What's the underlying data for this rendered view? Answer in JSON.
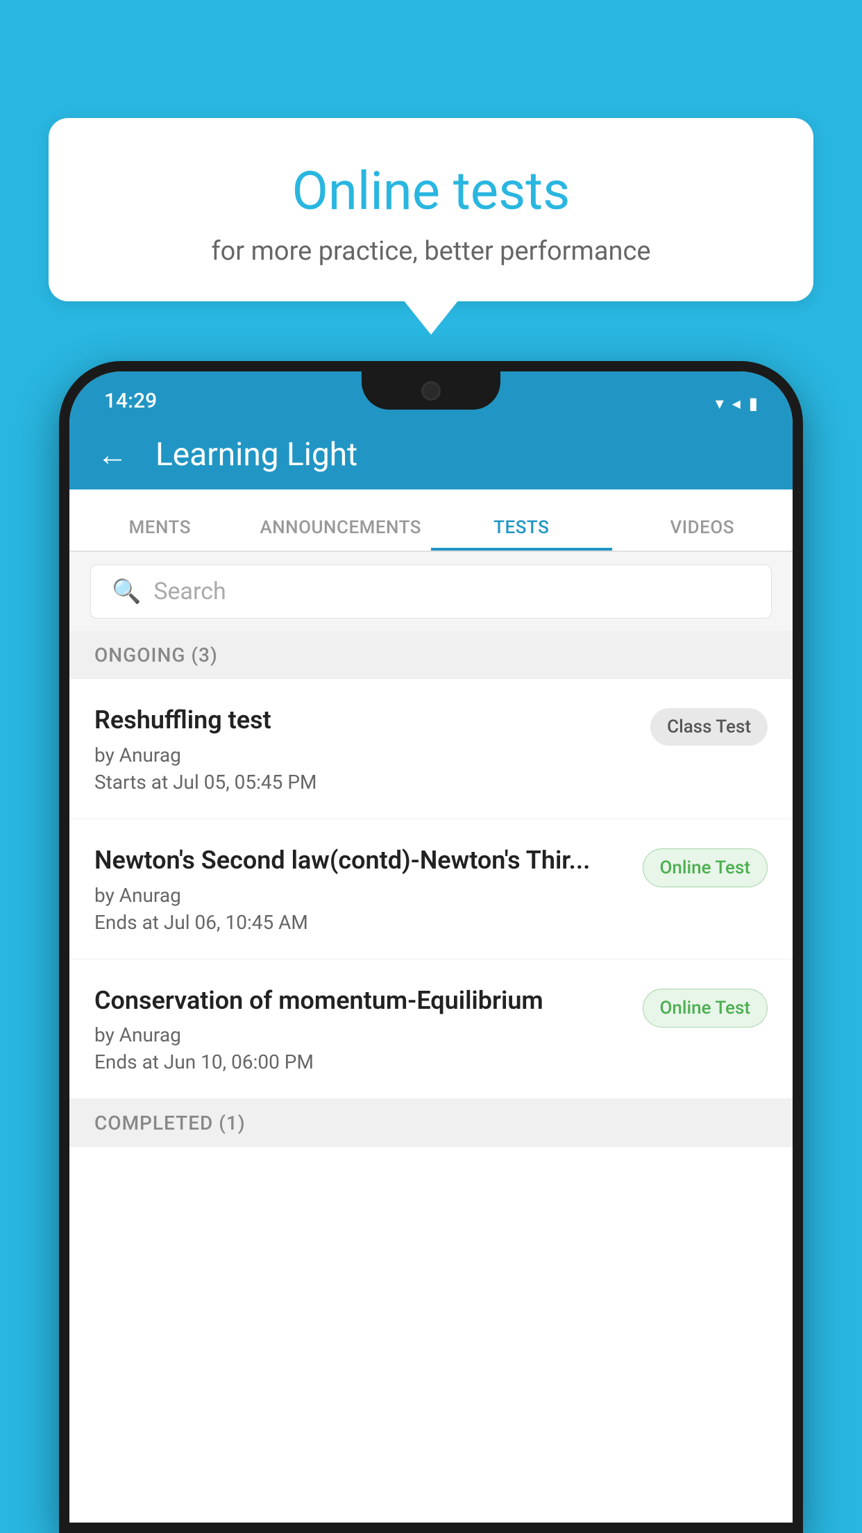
{
  "background_color": "#29b6e0",
  "speech_bubble": {
    "title": "Online tests",
    "subtitle": "for more practice, better performance"
  },
  "status_bar": {
    "time": "14:29",
    "wifi_icon": "▼",
    "signal_icon": "▲",
    "battery_icon": "▮"
  },
  "app_header": {
    "title": "Learning Light",
    "back_label": "←"
  },
  "tabs": [
    {
      "label": "MENTS",
      "active": false
    },
    {
      "label": "ANNOUNCEMENTS",
      "active": false
    },
    {
      "label": "TESTS",
      "active": true
    },
    {
      "label": "VIDEOS",
      "active": false
    }
  ],
  "search": {
    "placeholder": "Search"
  },
  "ongoing_section": {
    "header": "ONGOING (3)",
    "tests": [
      {
        "title": "Reshuffling test",
        "author": "by Anurag",
        "time": "Starts at  Jul 05, 05:45 PM",
        "badge": "Class Test",
        "badge_type": "class"
      },
      {
        "title": "Newton's Second law(contd)-Newton's Thir...",
        "author": "by Anurag",
        "time": "Ends at  Jul 06, 10:45 AM",
        "badge": "Online Test",
        "badge_type": "online"
      },
      {
        "title": "Conservation of momentum-Equilibrium",
        "author": "by Anurag",
        "time": "Ends at  Jun 10, 06:00 PM",
        "badge": "Online Test",
        "badge_type": "online"
      }
    ]
  },
  "completed_section": {
    "header": "COMPLETED (1)"
  }
}
